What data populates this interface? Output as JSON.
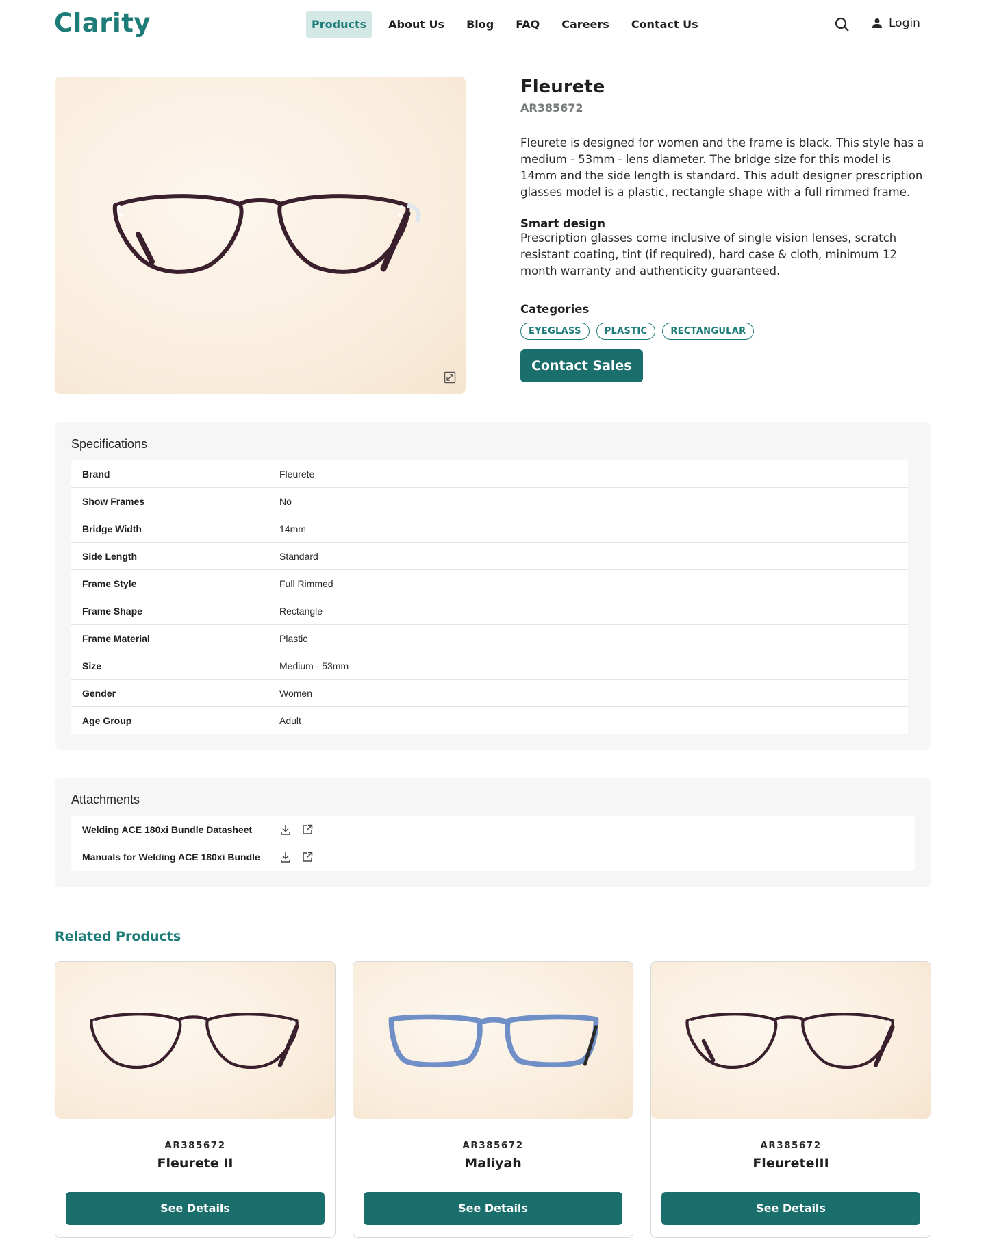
{
  "header": {
    "logo": "Clarity",
    "nav": [
      "Products",
      "About Us",
      "Blog",
      "FAQ",
      "Careers",
      "Contact Us"
    ],
    "active_nav": "Products",
    "login_label": "Login"
  },
  "product": {
    "name": "Fleurete",
    "code": "AR385672",
    "description": "Fleurete is designed for women and the frame is black. This style has a medium - 53mm - lens diameter. The bridge size for this model is 14mm and the side length is standard. This adult designer prescription glasses model is a plastic, rectangle shape with a full rimmed frame.",
    "smart_title": "Smart design",
    "smart_desc": "Prescription glasses come inclusive of single vision lenses, scratch resistant coating, tint (if required), hard case & cloth, minimum 12 month warranty and authenticity guaranteed.",
    "categories_title": "Categories",
    "categories": [
      "EYEGLASS",
      "PLASTIC",
      "RECTANGULAR"
    ],
    "contact_label": "Contact Sales"
  },
  "specifications": {
    "title": "Specifications",
    "rows": [
      {
        "key": "Brand",
        "value": "Fleurete"
      },
      {
        "key": "Show Frames",
        "value": "No"
      },
      {
        "key": "Bridge Width",
        "value": "14mm"
      },
      {
        "key": "Side Length",
        "value": "Standard"
      },
      {
        "key": "Frame Style",
        "value": "Full Rimmed"
      },
      {
        "key": "Frame Shape",
        "value": "Rectangle"
      },
      {
        "key": "Frame Material",
        "value": "Plastic"
      },
      {
        "key": "Size",
        "value": "Medium - 53mm"
      },
      {
        "key": "Gender",
        "value": "Women"
      },
      {
        "key": "Age Group",
        "value": "Adult"
      }
    ]
  },
  "attachments": {
    "title": "Attachments",
    "items": [
      "Welding ACE 180xi Bundle Datasheet",
      "Manuals for Welding ACE 180xi Bundle"
    ]
  },
  "related": {
    "title": "Related Products",
    "button_label": "See Details",
    "items": [
      {
        "code": "AR385672",
        "name": "Fleurete II",
        "frame_color": "#3a1f2c"
      },
      {
        "code": "AR385672",
        "name": "Maliyah",
        "frame_color": "#6f8fc6"
      },
      {
        "code": "AR385672",
        "name": "FleureteIII",
        "frame_color": "#3a1f2c"
      }
    ]
  },
  "colors": {
    "brand": "#1e7c78",
    "button": "#1a6e6c",
    "nav_active_bg": "#d4e8e6"
  }
}
